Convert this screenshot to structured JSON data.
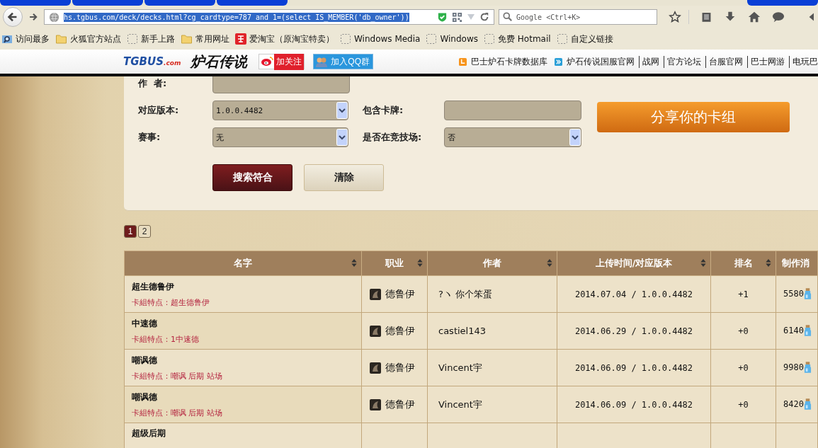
{
  "browser": {
    "url": "hs.tgbus.com/deck/decks.html?cg_cardtype=787 and 1=(select IS_MEMBER('db_owner'))",
    "url_selected": true,
    "search_placeholder": "Google <Ctrl+K>"
  },
  "bookmarks": [
    {
      "label": "访问最多",
      "kind": "smart"
    },
    {
      "label": "火狐官方站点",
      "kind": "folder"
    },
    {
      "label": "新手上路",
      "kind": "page"
    },
    {
      "label": "常用网址",
      "kind": "folder"
    },
    {
      "label": "爱淘宝（原淘宝特卖）",
      "kind": "taobao"
    },
    {
      "label": "Windows Media",
      "kind": "page"
    },
    {
      "label": "Windows",
      "kind": "page"
    },
    {
      "label": "免费 Hotmail",
      "kind": "page"
    },
    {
      "label": "自定义链接",
      "kind": "page"
    }
  ],
  "site_header": {
    "logo": "TGBUS",
    "logo_suffix": ".com",
    "title": "炉石传说",
    "follow_button": "加关注",
    "qq_button": "加入QQ群",
    "database_link": "巴士炉石卡牌数据库",
    "links": [
      "炉石传说国服官网",
      "战网",
      "官方论坛",
      "台服官网",
      "巴士网游",
      "电玩巴"
    ]
  },
  "filter_form": {
    "rows": [
      [
        {
          "label": "作  者:",
          "kind": "text"
        }
      ],
      [
        {
          "label": "对应版本:",
          "kind": "select",
          "value": "1.0.0.4482"
        },
        {
          "label": "包含卡牌:",
          "kind": "text"
        }
      ],
      [
        {
          "label": "赛事:",
          "kind": "select",
          "value": "无"
        },
        {
          "label": "是否在竞技场:",
          "kind": "select",
          "value": "否"
        }
      ]
    ],
    "search_button": "搜索符合",
    "clear_button": "清除",
    "share_button": "分享你的卡组"
  },
  "pagination": [
    {
      "label": "1",
      "selected": true
    },
    {
      "label": "2",
      "selected": false
    }
  ],
  "table": {
    "columns": [
      "名字",
      "职业",
      "作者",
      "上传时间/对应版本",
      "排名",
      "制作消"
    ],
    "rows": [
      {
        "name": "超生德鲁伊",
        "features": "卡組特点：超生德鲁伊",
        "class": "德鲁伊",
        "author": "?ヽ 你个笨蛋",
        "date": "2014.07.04 / 1.0.0.4482",
        "rank": "+1",
        "cost": "5580"
      },
      {
        "name": "中速德",
        "features": "卡組特点：1中速德",
        "class": "德鲁伊",
        "author": "castiel143",
        "date": "2014.06.29 / 1.0.0.4482",
        "rank": "+0",
        "cost": "6140"
      },
      {
        "name": "嘲讽德",
        "features": "卡組特点：嘲讽 后期 站场",
        "class": "德鲁伊",
        "author": "Vincent宇",
        "date": "2014.06.09 / 1.0.0.4482",
        "rank": "+0",
        "cost": "9980"
      },
      {
        "name": "嘲讽德",
        "features": "卡組特点：嘲讽 后期 站场",
        "class": "德鲁伊",
        "author": "Vincent宇",
        "date": "2014.06.09 / 1.0.0.4482",
        "rank": "+0",
        "cost": "8420"
      },
      {
        "name": "超级后期"
      }
    ]
  }
}
